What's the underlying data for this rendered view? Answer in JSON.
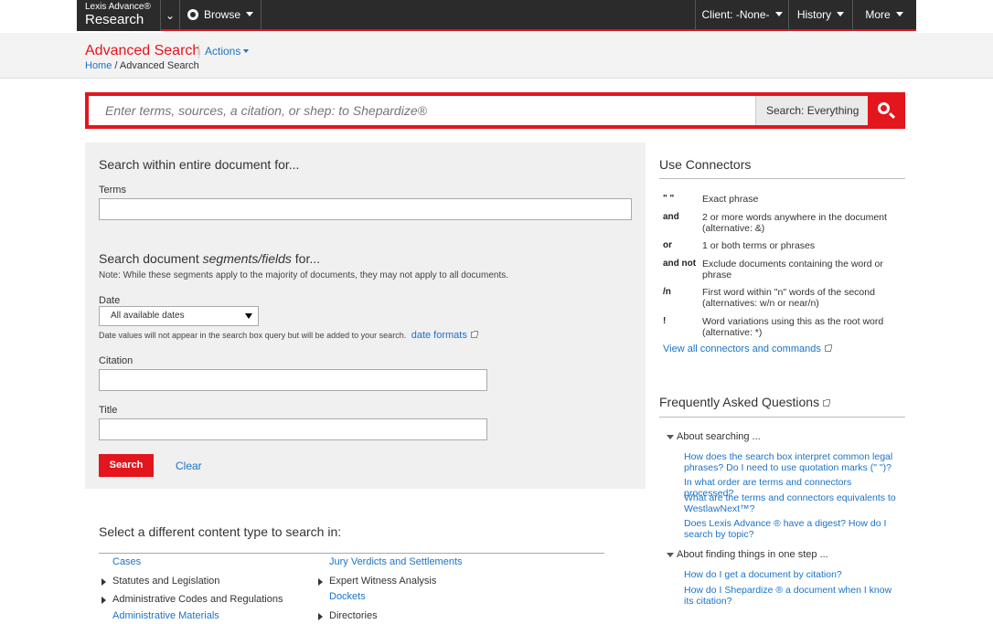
{
  "topbar": {
    "brand_line1": "Lexis Advance®",
    "brand_line2": "Research",
    "browse": "Browse",
    "client": "Client: -None-",
    "history": "History",
    "more": "More"
  },
  "header": {
    "title": "Advanced Search",
    "actions": "Actions",
    "breadcrumb_home": "Home",
    "breadcrumb_sep": " / ",
    "breadcrumb_current": "Advanced Search"
  },
  "search": {
    "placeholder": "Enter terms, sources, a citation, or shep: to Shepardize®",
    "scope": "Search: Everything"
  },
  "form": {
    "heading1": "Search within entire document for...",
    "terms_label": "Terms",
    "heading2_pre": "Search document ",
    "heading2_em": "segments/fields",
    "heading2_post": " for...",
    "note": "Note: While these segments apply to the majority of documents, they may not apply to all documents.",
    "date_label": "Date",
    "date_value": "All available dates",
    "date_note": "Date values will not appear in the search box query but will be added to your search.",
    "date_formats": "date formats",
    "citation_label": "Citation",
    "title_label": "Title",
    "search_button": "Search",
    "clear_button": "Clear"
  },
  "content_types": {
    "heading": "Select a different content type to search in:",
    "col1": [
      {
        "label": "Cases",
        "link": true,
        "expand": false
      },
      {
        "label": "Statutes and Legislation",
        "link": false,
        "expand": true
      },
      {
        "label": "Administrative Codes and Regulations",
        "link": false,
        "expand": true
      },
      {
        "label": "Administrative Materials",
        "link": true,
        "expand": false
      }
    ],
    "col2": [
      {
        "label": "Jury Verdicts and Settlements",
        "link": true,
        "expand": false
      },
      {
        "label": "Expert Witness Analysis",
        "link": false,
        "expand": true
      },
      {
        "label": "Dockets",
        "link": true,
        "expand": false
      },
      {
        "label": "Directories",
        "link": false,
        "expand": true
      }
    ]
  },
  "connectors": {
    "heading": "Use Connectors",
    "items": [
      {
        "key": "\" \"",
        "desc": "Exact phrase"
      },
      {
        "key": "and",
        "desc": "2 or more words anywhere in the document (alternative: &)"
      },
      {
        "key": "or",
        "desc": "1 or both terms or phrases"
      },
      {
        "key": "and not",
        "desc": "Exclude documents containing the word or phrase"
      },
      {
        "key": "/n",
        "desc": "First word within \"n\" words of the second (alternatives: w/n or near/n)"
      },
      {
        "key": "!",
        "desc": "Word variations using this as the root word (alternative: *)"
      }
    ],
    "view_all": "View all connectors and commands"
  },
  "faq": {
    "heading": "Frequently Asked Questions",
    "section1": "About searching ...",
    "section1_items": [
      "How does the search box interpret common legal phrases? Do I need to use quotation marks (\" \")?",
      "In what order are terms and connectors processed?",
      "What are the terms and connectors equivalents to WestlawNext™?",
      "Does Lexis Advance ® have a digest? How do I search by topic?"
    ],
    "section2": "About finding things in one step ...",
    "section2_items": [
      "How do I get a document by citation?",
      "How do I Shepardize ® a document when I know its citation?"
    ]
  }
}
